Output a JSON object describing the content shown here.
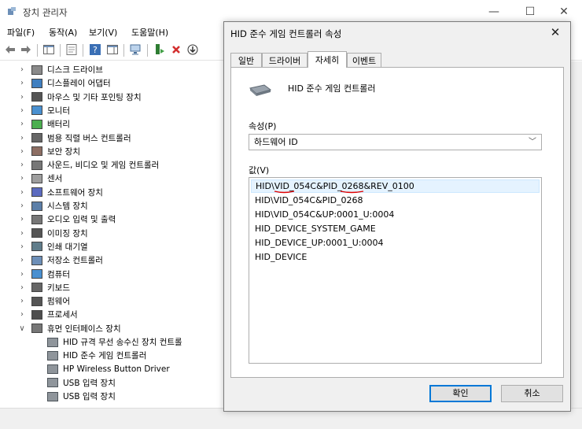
{
  "main_window": {
    "title": "장치 관리자",
    "controls": {
      "minimize": "—",
      "maximize": "☐",
      "close": "✕"
    },
    "menu": [
      "파일(F)",
      "동작(A)",
      "보기(V)",
      "도움말(H)"
    ]
  },
  "tree": {
    "items": [
      {
        "label": "디스크 드라이브",
        "expanded": false,
        "icon": "disk-icon"
      },
      {
        "label": "디스플레이 어댑터",
        "expanded": false,
        "icon": "display-adapter-icon"
      },
      {
        "label": "마우스 및 기타 포인팅 장치",
        "expanded": false,
        "icon": "mouse-icon"
      },
      {
        "label": "모니터",
        "expanded": false,
        "icon": "monitor-icon"
      },
      {
        "label": "배터리",
        "expanded": false,
        "icon": "battery-icon"
      },
      {
        "label": "범용 직렬 버스 컨트롤러",
        "expanded": false,
        "icon": "usb-controller-icon"
      },
      {
        "label": "보안 장치",
        "expanded": false,
        "icon": "security-icon"
      },
      {
        "label": "사운드, 비디오 및 게임 컨트롤러",
        "expanded": false,
        "icon": "sound-icon"
      },
      {
        "label": "센서",
        "expanded": false,
        "icon": "sensor-icon"
      },
      {
        "label": "소프트웨어 장치",
        "expanded": false,
        "icon": "software-icon"
      },
      {
        "label": "시스템 장치",
        "expanded": false,
        "icon": "system-icon"
      },
      {
        "label": "오디오 입력 및 출력",
        "expanded": false,
        "icon": "audio-icon"
      },
      {
        "label": "이미징 장치",
        "expanded": false,
        "icon": "camera-icon"
      },
      {
        "label": "인쇄 대기열",
        "expanded": false,
        "icon": "printer-icon"
      },
      {
        "label": "저장소 컨트롤러",
        "expanded": false,
        "icon": "storage-icon"
      },
      {
        "label": "컴퓨터",
        "expanded": false,
        "icon": "computer-icon"
      },
      {
        "label": "키보드",
        "expanded": false,
        "icon": "keyboard-icon"
      },
      {
        "label": "펌웨어",
        "expanded": false,
        "icon": "firmware-icon"
      },
      {
        "label": "프로세서",
        "expanded": false,
        "icon": "processor-icon"
      },
      {
        "label": "휴먼 인터페이스 장치",
        "expanded": true,
        "icon": "hid-icon"
      }
    ],
    "hid_children": [
      "HID 규격 무선 송수신 장치 컨트롤",
      "HID 준수 게임 컨트롤러",
      "HP Wireless Button Driver",
      "USB 입력 장치",
      "USB 입력 장치"
    ]
  },
  "dialog": {
    "title": "HID 준수 게임 컨트롤러 속성",
    "close": "✕",
    "tabs": [
      "일반",
      "드라이버",
      "자세히",
      "이벤트"
    ],
    "active_tab": "자세히",
    "device_name": "HID 준수 게임 컨트롤러",
    "property_label": "속성(P)",
    "property_value": "하드웨어 ID",
    "value_label": "값(V)",
    "values": [
      "HID\\VID_054C&PID_0268&REV_0100",
      "HID\\VID_054C&PID_0268",
      "HID\\VID_054C&UP:0001_U:0004",
      "HID_DEVICE_SYSTEM_GAME",
      "HID_DEVICE_UP:0001_U:0004",
      "HID_DEVICE"
    ],
    "ok": "확인",
    "cancel": "취소"
  },
  "colors": {
    "accent": "#0078d7",
    "selection": "#e5f3ff",
    "annotation": "#e00000"
  }
}
